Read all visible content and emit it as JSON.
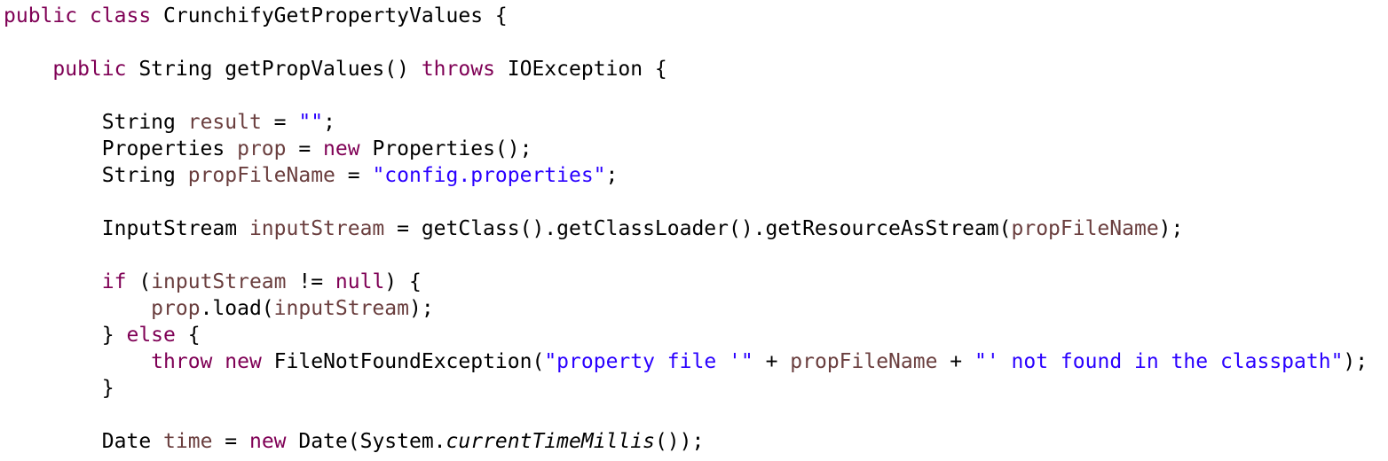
{
  "editor": {
    "lines": [
      {
        "indent": "",
        "tokens": [
          {
            "t": "public",
            "c": "k"
          },
          {
            "t": " ",
            "c": "p"
          },
          {
            "t": "class",
            "c": "k"
          },
          {
            "t": " CrunchifyGetPropertyValues {",
            "c": "p"
          }
        ]
      },
      {
        "indent": "",
        "tokens": []
      },
      {
        "indent": "    ",
        "tokens": [
          {
            "t": "public",
            "c": "k"
          },
          {
            "t": " String getPropValues() ",
            "c": "p"
          },
          {
            "t": "throws",
            "c": "k"
          },
          {
            "t": " IOException {",
            "c": "p"
          }
        ]
      },
      {
        "indent": "",
        "tokens": []
      },
      {
        "indent": "        ",
        "tokens": [
          {
            "t": "String ",
            "c": "p"
          },
          {
            "t": "result",
            "c": "v"
          },
          {
            "t": " = ",
            "c": "p"
          },
          {
            "t": "\"\"",
            "c": "s"
          },
          {
            "t": ";",
            "c": "p"
          }
        ]
      },
      {
        "indent": "        ",
        "tokens": [
          {
            "t": "Properties ",
            "c": "p"
          },
          {
            "t": "prop",
            "c": "v"
          },
          {
            "t": " = ",
            "c": "p"
          },
          {
            "t": "new",
            "c": "k"
          },
          {
            "t": " Properties();",
            "c": "p"
          }
        ]
      },
      {
        "indent": "        ",
        "tokens": [
          {
            "t": "String ",
            "c": "p"
          },
          {
            "t": "propFileName",
            "c": "v"
          },
          {
            "t": " = ",
            "c": "p"
          },
          {
            "t": "\"config.properties\"",
            "c": "s"
          },
          {
            "t": ";",
            "c": "p"
          }
        ]
      },
      {
        "indent": "",
        "tokens": []
      },
      {
        "indent": "        ",
        "tokens": [
          {
            "t": "InputStream ",
            "c": "p"
          },
          {
            "t": "inputStream",
            "c": "v"
          },
          {
            "t": " = getClass().getClassLoader().getResourceAsStream(",
            "c": "p"
          },
          {
            "t": "propFileName",
            "c": "v"
          },
          {
            "t": ");",
            "c": "p"
          }
        ]
      },
      {
        "indent": "",
        "tokens": []
      },
      {
        "indent": "        ",
        "tokens": [
          {
            "t": "if",
            "c": "k"
          },
          {
            "t": " (",
            "c": "p"
          },
          {
            "t": "inputStream",
            "c": "v"
          },
          {
            "t": " != ",
            "c": "p"
          },
          {
            "t": "null",
            "c": "k"
          },
          {
            "t": ") {",
            "c": "p"
          }
        ]
      },
      {
        "indent": "            ",
        "tokens": [
          {
            "t": "prop",
            "c": "v"
          },
          {
            "t": ".load(",
            "c": "p"
          },
          {
            "t": "inputStream",
            "c": "v"
          },
          {
            "t": ");",
            "c": "p"
          }
        ]
      },
      {
        "indent": "        ",
        "tokens": [
          {
            "t": "} ",
            "c": "p"
          },
          {
            "t": "else",
            "c": "k"
          },
          {
            "t": " {",
            "c": "p"
          }
        ]
      },
      {
        "indent": "            ",
        "tokens": [
          {
            "t": "throw",
            "c": "k"
          },
          {
            "t": " ",
            "c": "p"
          },
          {
            "t": "new",
            "c": "k"
          },
          {
            "t": " FileNotFoundException(",
            "c": "p"
          },
          {
            "t": "\"property file '\"",
            "c": "s"
          },
          {
            "t": " + ",
            "c": "p"
          },
          {
            "t": "propFileName",
            "c": "v"
          },
          {
            "t": " + ",
            "c": "p"
          },
          {
            "t": "\"' not found in the classpath\"",
            "c": "s"
          },
          {
            "t": ");",
            "c": "p"
          }
        ]
      },
      {
        "indent": "        ",
        "tokens": [
          {
            "t": "}",
            "c": "p"
          }
        ]
      },
      {
        "indent": "",
        "tokens": []
      },
      {
        "indent": "        ",
        "tokens": [
          {
            "t": "Date ",
            "c": "p"
          },
          {
            "t": "time",
            "c": "v"
          },
          {
            "t": " = ",
            "c": "p"
          },
          {
            "t": "new",
            "c": "k"
          },
          {
            "t": " Date(System.",
            "c": "p"
          },
          {
            "t": "currentTimeMillis",
            "c": "i"
          },
          {
            "t": "());",
            "c": "p"
          }
        ]
      }
    ]
  },
  "colors": {
    "keyword": "#7f0055",
    "variable": "#6a3e3e",
    "string": "#2a00ff",
    "plain": "#000000",
    "background": "#ffffff"
  }
}
